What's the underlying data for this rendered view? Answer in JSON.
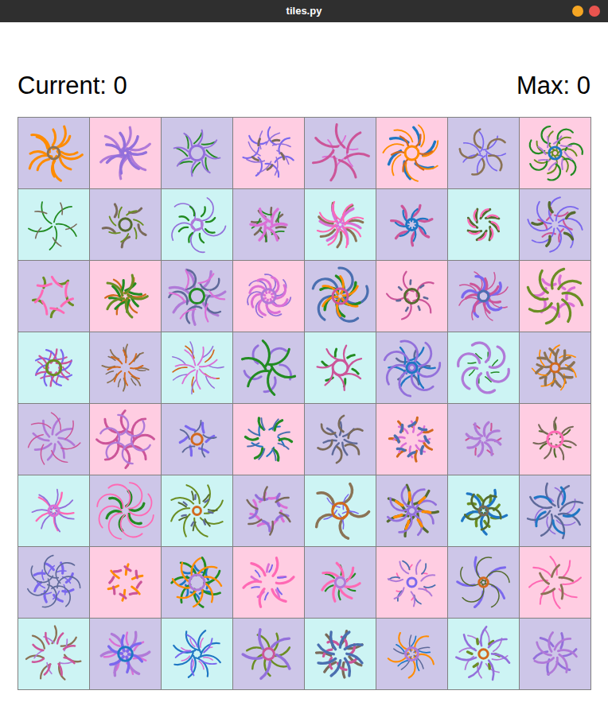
{
  "window": {
    "title": "tiles.py"
  },
  "score": {
    "current": "Current: 0",
    "max": "Max: 0"
  },
  "grid": {
    "rows": [
      [
        {
          "color": "#cdc6e8"
        },
        {
          "color": "#ffcde2"
        },
        {
          "color": "#cdc6e8"
        },
        {
          "color": "#ffcde2"
        },
        {
          "color": "#cdc6e8"
        },
        {
          "color": "#ffcde2"
        },
        {
          "color": "#cdc6e8"
        },
        {
          "color": "#ffcde2"
        }
      ],
      [
        {
          "color": "#cdf4f4"
        },
        {
          "color": "#cdc6e8"
        },
        {
          "color": "#cdf4f4"
        },
        {
          "color": "#cdc6e8"
        },
        {
          "color": "#cdf4f4"
        },
        {
          "color": "#cdc6e8"
        },
        {
          "color": "#cdf4f4"
        },
        {
          "color": "#cdc6e8"
        }
      ],
      [
        {
          "color": "#cdc6e8"
        },
        {
          "color": "#ffcde2"
        },
        {
          "color": "#cdc6e8"
        },
        {
          "color": "#ffcde2"
        },
        {
          "color": "#cdc6e8"
        },
        {
          "color": "#ffcde2"
        },
        {
          "color": "#cdc6e8"
        },
        {
          "color": "#ffcde2"
        }
      ],
      [
        {
          "color": "#cdf4f4"
        },
        {
          "color": "#cdc6e8"
        },
        {
          "color": "#cdf4f4"
        },
        {
          "color": "#cdc6e8"
        },
        {
          "color": "#cdf4f4"
        },
        {
          "color": "#cdc6e8"
        },
        {
          "color": "#cdf4f4"
        },
        {
          "color": "#cdc6e8"
        }
      ],
      [
        {
          "color": "#cdc6e8"
        },
        {
          "color": "#ffcde2"
        },
        {
          "color": "#cdc6e8"
        },
        {
          "color": "#ffcde2"
        },
        {
          "color": "#cdc6e8"
        },
        {
          "color": "#ffcde2"
        },
        {
          "color": "#cdc6e8"
        },
        {
          "color": "#ffcde2"
        }
      ],
      [
        {
          "color": "#cdf4f4"
        },
        {
          "color": "#cdc6e8"
        },
        {
          "color": "#cdf4f4"
        },
        {
          "color": "#cdc6e8"
        },
        {
          "color": "#cdf4f4"
        },
        {
          "color": "#cdc6e8"
        },
        {
          "color": "#cdf4f4"
        },
        {
          "color": "#cdc6e8"
        }
      ],
      [
        {
          "color": "#cdc6e8"
        },
        {
          "color": "#ffcde2"
        },
        {
          "color": "#cdc6e8"
        },
        {
          "color": "#ffcde2"
        },
        {
          "color": "#cdc6e8"
        },
        {
          "color": "#ffcde2"
        },
        {
          "color": "#cdc6e8"
        },
        {
          "color": "#ffcde2"
        }
      ],
      [
        {
          "color": "#cdf4f4"
        },
        {
          "color": "#cdc6e8"
        },
        {
          "color": "#cdf4f4"
        },
        {
          "color": "#cdc6e8"
        },
        {
          "color": "#cdf4f4"
        },
        {
          "color": "#cdc6e8"
        },
        {
          "color": "#cdf4f4"
        },
        {
          "color": "#cdc6e8"
        }
      ]
    ]
  }
}
